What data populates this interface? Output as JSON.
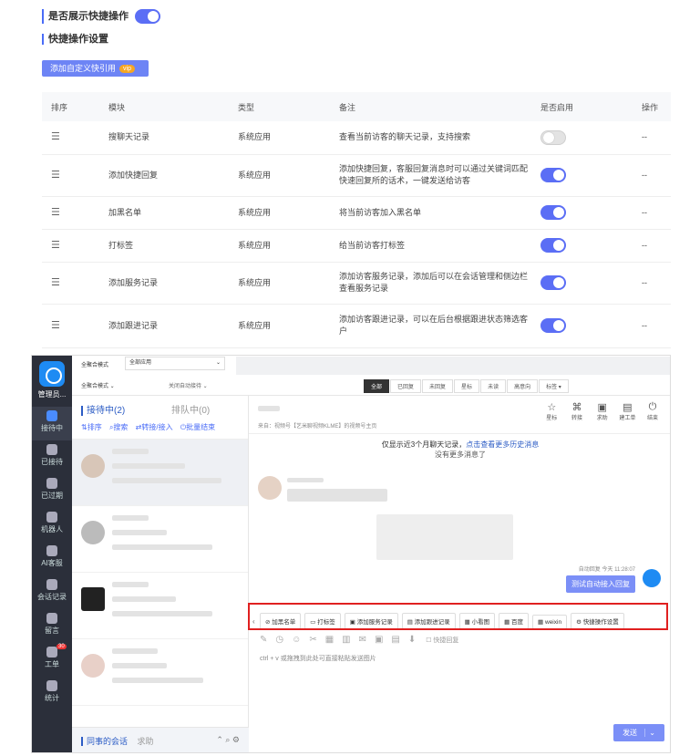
{
  "settings": {
    "show_quick_label": "是否展示快捷操作",
    "quick_config_title": "快捷操作设置",
    "add_button": "添加自定义快引用",
    "add_badge": "vip"
  },
  "table": {
    "headers": [
      "排序",
      "模块",
      "类型",
      "备注",
      "是否启用",
      "操作"
    ],
    "rows": [
      {
        "module": "搜聊天记录",
        "type": "系统应用",
        "note": "查看当前访客的聊天记录，支持搜索",
        "enabled": false,
        "op": "--"
      },
      {
        "module": "添加快捷回复",
        "type": "系统应用",
        "note": "添加快捷回复，客服回复消息时可以通过关键词匹配快速回复所的话术，一键发送给访客",
        "enabled": true,
        "op": "--"
      },
      {
        "module": "加黑名单",
        "type": "系统应用",
        "note": "将当前访客加入黑名单",
        "enabled": true,
        "op": "--"
      },
      {
        "module": "打标签",
        "type": "系统应用",
        "note": "给当前访客打标签",
        "enabled": true,
        "op": "--"
      },
      {
        "module": "添加服务记录",
        "type": "系统应用",
        "note": "添加访客服务记录，添加后可以在会话管理和侧边栏查看服务记录",
        "enabled": true,
        "op": "--"
      },
      {
        "module": "添加跟进记录",
        "type": "系统应用",
        "note": "添加访客跟进记录，可以在后台根据跟进状态筛选客户",
        "enabled": true,
        "op": "--"
      }
    ]
  },
  "app": {
    "agent": "管理员...",
    "nav": [
      "接待中",
      "已接待",
      "已过期",
      "机器人",
      "AI客服",
      "会话记录",
      "留言",
      "工单",
      "统计"
    ],
    "work_badge": "30",
    "mode_label": "全聚合模式",
    "mode_select": "全部应用",
    "mode_label2": "全聚合模式",
    "auto_select": "关闭自动接待",
    "filters": [
      "全部",
      "已回复",
      "未回复",
      "星标",
      "未读",
      "高意向",
      "标签"
    ],
    "tab_receiving": "接待中(2)",
    "tab_queue": "排队中(0)",
    "list_actions": [
      "排序",
      "搜索",
      "转接/接入",
      "批量结束"
    ],
    "source": "来自：视频号【艺米聊视频KLME】的视频号主页",
    "header_icons": [
      "星标",
      "转接",
      "求助",
      "建工单",
      "结束"
    ],
    "history_note": "仅显示近3个月聊天记录，",
    "history_link": "点击查看更多历史消息",
    "no_more": "没有更多消息了",
    "auto_reply_meta": "自动回复  今天 11:28:07",
    "auto_reply_text": "测试自动接入回复",
    "quick_actions": [
      "加黑名单",
      "打标签",
      "添加服务记录",
      "添加跟进记录",
      "小看图",
      "百度",
      "weixin",
      "快捷操作设置"
    ],
    "quick_reply_label": "快捷回复",
    "input_placeholder": "ctrl + v 或拖拽到此处可直接粘贴发送图片",
    "colleague": "同事的会话",
    "help": "求助",
    "send": "发送"
  },
  "colors": {
    "accent": "#5b6ef5",
    "highlight": "#e02020",
    "sidebar": "#2b2f3a"
  }
}
